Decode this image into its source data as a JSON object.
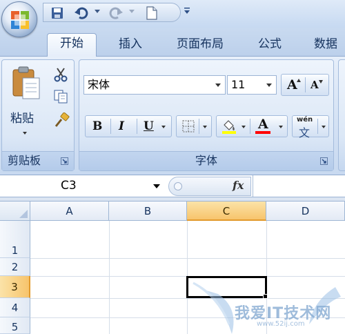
{
  "tabs": [
    {
      "label": "开始",
      "active": true
    },
    {
      "label": "插入"
    },
    {
      "label": "页面布局"
    },
    {
      "label": "公式"
    },
    {
      "label": "数据"
    }
  ],
  "clipboard": {
    "paste_label": "粘贴",
    "group_label": "剪贴板"
  },
  "font": {
    "name": "宋体",
    "size": "11",
    "bold_label": "B",
    "italic_label": "I",
    "underline_label": "U",
    "grow_label": "A",
    "shrink_label": "A",
    "font_color_label": "A",
    "phonetic_top": "wén",
    "phonetic_bottom": "文",
    "group_label": "字体",
    "fill_color": "#ffff00",
    "font_color": "#ff0000"
  },
  "formula_bar": {
    "name_box": "C3",
    "fx_label": "fx"
  },
  "grid": {
    "columns": [
      "A",
      "B",
      "C",
      "D"
    ],
    "rows": [
      "1",
      "2",
      "3",
      "4",
      "5"
    ],
    "selected_column": "C",
    "selected_row": "3"
  },
  "watermark": {
    "title": "我爱IT技术网",
    "url": "www.52ij.com"
  },
  "colors": {
    "accent": "#f7c46c",
    "ribbon": "#d3e1f4"
  }
}
